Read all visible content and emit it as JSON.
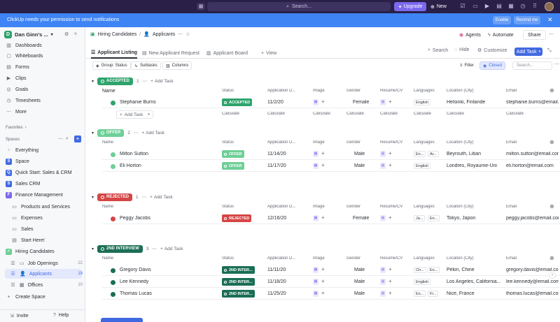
{
  "topbar": {
    "search_placeholder": "Search...",
    "upgrade_label": "Upgrade",
    "new_label": "New"
  },
  "notification": {
    "message": "ClickUp needs your permission to send notifications",
    "enable_label": "Enable",
    "remind_label": "Remind me"
  },
  "sidebar": {
    "workspace_initial": "D",
    "workspace_name": "Dan Ginn's ...",
    "items": [
      {
        "label": "Dashboards",
        "icon": "dashboard-icon"
      },
      {
        "label": "Whiteboards",
        "icon": "whiteboard-icon"
      },
      {
        "label": "Forms",
        "icon": "form-icon"
      },
      {
        "label": "Clips",
        "icon": "clip-icon"
      },
      {
        "label": "Goals",
        "icon": "goal-icon"
      },
      {
        "label": "Timesheets",
        "icon": "timesheet-icon"
      },
      {
        "label": "More",
        "icon": "more-icon"
      }
    ],
    "favorites_label": "Favorites",
    "spaces_label": "Spaces",
    "spaces": [
      {
        "label": "Everything",
        "initial": "",
        "color": ""
      },
      {
        "label": "Space",
        "initial": "S",
        "color": "#4169e1"
      },
      {
        "label": "Quick Start: Sales & CRM",
        "initial": "Q",
        "color": "#4169e1"
      },
      {
        "label": "Sales CRM",
        "initial": "S",
        "color": "#4169e1"
      },
      {
        "label": "Finance Management",
        "initial": "F",
        "color": "#7b68ee"
      }
    ],
    "finance_children": [
      "Products and Services",
      "Expenses",
      "Sales",
      "Start Here!"
    ],
    "hiring_label": "Hiring Candidates",
    "hiring_children": [
      {
        "label": "Job Openings",
        "count": "22"
      },
      {
        "label": "Applicants",
        "count": "19"
      },
      {
        "label": "Offices",
        "count": "10"
      }
    ],
    "create_space_label": "Create Space",
    "invite_label": "Invite",
    "help_label": "Help"
  },
  "header": {
    "crumb_space": "Hiring Candidates",
    "crumb_sep": "/",
    "crumb_list": "Applicants",
    "agents_label": "Agents",
    "automate_label": "Automate",
    "share_label": "Share"
  },
  "tabs": {
    "items": [
      "Applicant Listing",
      "New Applicant Request",
      "Applicant Board"
    ],
    "add_view_label": "View",
    "search_label": "Search",
    "hide_label": "Hide",
    "customize_label": "Customize",
    "add_task_label": "Add Task"
  },
  "filters": {
    "group_label": "Group: Status",
    "subtasks_label": "Subtasks",
    "columns_label": "Columns",
    "filter_label": "Filter",
    "closed_label": "Closed",
    "search_placeholder": "Search..."
  },
  "columns": {
    "name": "Name",
    "status": "Status",
    "app_date": "Application D...",
    "image": "Image",
    "gender": "Gender",
    "resume": "Resume/CV",
    "languages": "Languages",
    "location": "Location (City)",
    "email": "Email"
  },
  "add_task_label": "Add Task",
  "calculate_label": "Calculate",
  "colors": {
    "accepted": "#2ea36b",
    "offer": "#6fcf97",
    "rejected": "#d64545",
    "interview": "#1b6e55",
    "accent": "#4169e1"
  },
  "groups": [
    {
      "status": "ACCEPTED",
      "count": "1",
      "color_key": "accepted",
      "rows": [
        {
          "name": "Stephanie Burns",
          "date": "11/2/20",
          "gender": "Female",
          "langs": [
            "English"
          ],
          "location": "Helsinki, Finlande",
          "email": "stephanie.burns@email.com"
        }
      ],
      "show_calc": true
    },
    {
      "status": "OFFER",
      "count": "2",
      "color_key": "offer",
      "rows": [
        {
          "name": "Milton Sutton",
          "date": "11/14/20",
          "gender": "Male",
          "langs": [
            "En...",
            "Ar..."
          ],
          "location": "Beyrouth, Liban",
          "email": "milton.sutton@email.com"
        },
        {
          "name": "Eli Horton",
          "date": "11/17/20",
          "gender": "Male",
          "langs": [
            "English"
          ],
          "location": "Londres, Royaume-Uni",
          "email": "eli.horton@email.com"
        }
      ],
      "show_calc": false
    },
    {
      "status": "REJECTED",
      "count": "1",
      "color_key": "rejected",
      "rows": [
        {
          "name": "Peggy Jacobs",
          "date": "12/16/20",
          "gender": "Female",
          "langs": [
            "Ja...",
            "En..."
          ],
          "location": "Tokyo, Japon",
          "email": "peggy.jacobs@email.com"
        }
      ],
      "show_calc": false
    },
    {
      "status": "2ND INTERVIEW",
      "count": "3",
      "color_key": "interview",
      "rows": [
        {
          "name": "Gregory Davis",
          "date": "11/11/20",
          "gender": "Male",
          "langs": [
            "Ch...",
            "En..."
          ],
          "location": "Pékin, Chine",
          "email": "gregory.davis@email.com"
        },
        {
          "name": "Lee Kennedy",
          "date": "11/18/20",
          "gender": "Male",
          "langs": [
            "English"
          ],
          "location": "Los Angeles, California...",
          "email": "lee.kennedy@email.com"
        },
        {
          "name": "Thomas Lucas",
          "date": "11/25/20",
          "gender": "Male",
          "langs": [
            "En...",
            "Fr..."
          ],
          "location": "Nice, France",
          "email": "thomas.lucas@email.com"
        }
      ],
      "show_calc": false
    }
  ],
  "row_status_labels": {
    "ACCEPTED": "ACCEPTED",
    "OFFER": "OFFER",
    "REJECTED": "REJECTED",
    "2ND INTERVIEW": "2ND INTER..."
  }
}
